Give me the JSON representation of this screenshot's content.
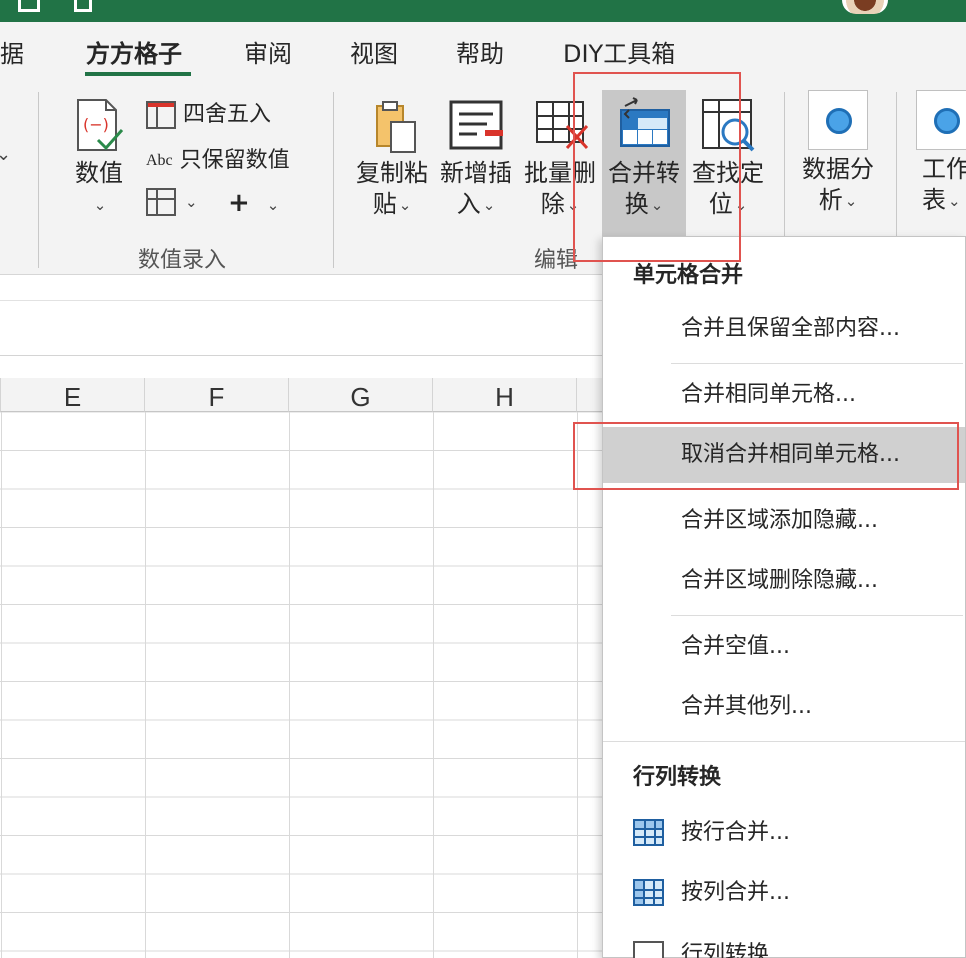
{
  "tabs": [
    {
      "label": "数据",
      "active": false
    },
    {
      "label": "方方格子",
      "active": true
    },
    {
      "label": "审阅",
      "active": false
    },
    {
      "label": "视图",
      "active": false
    },
    {
      "label": "帮助",
      "active": false
    },
    {
      "label": "DIY工具箱",
      "active": false
    }
  ],
  "ribbon": {
    "numeric_entry": {
      "value_button": "数值",
      "round_label": "四舍五入",
      "keep_value_label": "只保留数值",
      "abc_label": "Abc",
      "plus_label": "+",
      "group_label": "数值录入"
    },
    "edit": {
      "copy_paste": [
        "复制粘",
        "贴"
      ],
      "insert": [
        "新增插",
        "入"
      ],
      "batch_delete": [
        "批量删",
        "除"
      ],
      "merge_convert": [
        "合并转",
        "换"
      ],
      "find_locate": [
        "查找定",
        "位"
      ],
      "group_label": "编辑"
    },
    "analysis": [
      "数据分",
      "析"
    ],
    "worksheet": [
      "工作",
      "表"
    ]
  },
  "grid": {
    "columns": [
      "E",
      "F",
      "G",
      "H"
    ]
  },
  "menu": {
    "section1_title": "单元格合并",
    "section1_items": [
      "合并且保留全部内容...",
      "合并相同单元格...",
      "取消合并相同单元格...",
      "合并区域添加隐藏...",
      "合并区域删除隐藏...",
      "合并空值...",
      "合并其他列..."
    ],
    "section2_title": "行列转换",
    "section2_items": [
      "按行合并...",
      "按列合并...",
      "行列转换"
    ]
  },
  "colors": {
    "titlebar": "#217346",
    "annotation": "#e0534f",
    "highlight": "#d0d0d0"
  }
}
